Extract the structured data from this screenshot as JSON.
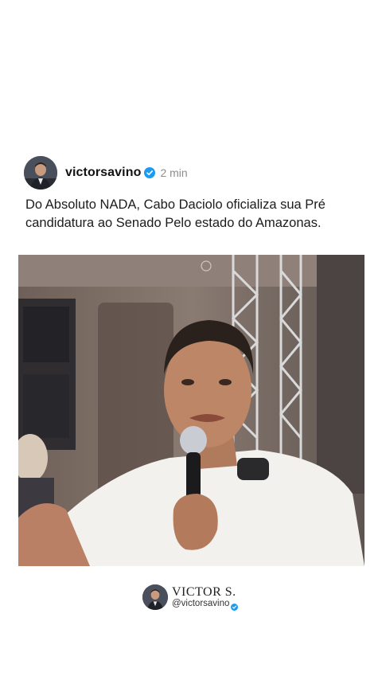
{
  "post": {
    "username": "victorsavino",
    "time": "2 min",
    "caption": "Do Absoluto NADA, Cabo Daciolo oficializa sua Pré\ncandidatura ao Senado Pelo estado do Amazonas."
  },
  "footer": {
    "name": "VICTOR S.",
    "handle": "@victorsavino"
  },
  "icons": {
    "verified": "verified-badge-icon"
  },
  "colors": {
    "verified": "#1d9bf0",
    "background": "#ffffff",
    "time": "#8d8d8d"
  }
}
